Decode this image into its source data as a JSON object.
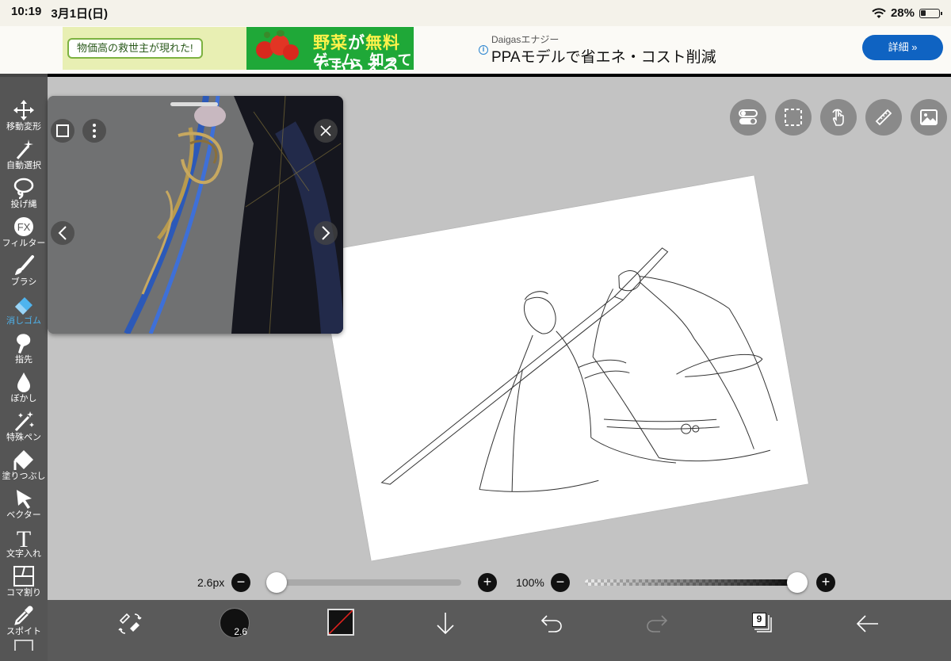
{
  "status": {
    "time": "10:19",
    "date": "3月1日(日)",
    "battery": "28%"
  },
  "ads": {
    "ad1": {
      "tagline": "物価高の救世主が現れた!",
      "headline_a": "野菜",
      "headline_b": "が",
      "headline_c": "無料",
      "headline_d": "でもらえる",
      "headline2": "ゲーム、知ってる?"
    },
    "ad2": {
      "sponsor": "Daigasエナジー",
      "headline": "PPAモデルで省エネ・コスト削減",
      "button": "詳細 »"
    }
  },
  "toolbar": {
    "items": [
      {
        "label": "移動変形",
        "icon": "move-icon"
      },
      {
        "label": "自動選択",
        "icon": "magic-wand-icon"
      },
      {
        "label": "投げ縄",
        "icon": "lasso-icon"
      },
      {
        "label": "フィルター",
        "icon": "fx-icon",
        "glyph": "FX"
      },
      {
        "label": "ブラシ",
        "icon": "brush-icon"
      },
      {
        "label": "消しゴム",
        "icon": "eraser-icon",
        "active": true
      },
      {
        "label": "指先",
        "icon": "finger-icon"
      },
      {
        "label": "ぼかし",
        "icon": "blur-drop-icon"
      },
      {
        "label": "特殊ペン",
        "icon": "special-pen-icon"
      },
      {
        "label": "塗りつぶし",
        "icon": "fill-bucket-icon"
      },
      {
        "label": "ベクター",
        "icon": "vector-cursor-icon"
      },
      {
        "label": "文字入れ",
        "icon": "text-icon",
        "glyph": "T"
      },
      {
        "label": "コマ割り",
        "icon": "panel-divide-icon"
      },
      {
        "label": "スポイト",
        "icon": "eyedropper-icon"
      }
    ]
  },
  "sliders": {
    "size_label": "2.6px",
    "opacity_label": "100%",
    "size_value": 0.0,
    "opacity_value": 1.0
  },
  "bottombar": {
    "brush_size": "2.6",
    "layer_count": "9",
    "accent": "#4fb4ee"
  }
}
